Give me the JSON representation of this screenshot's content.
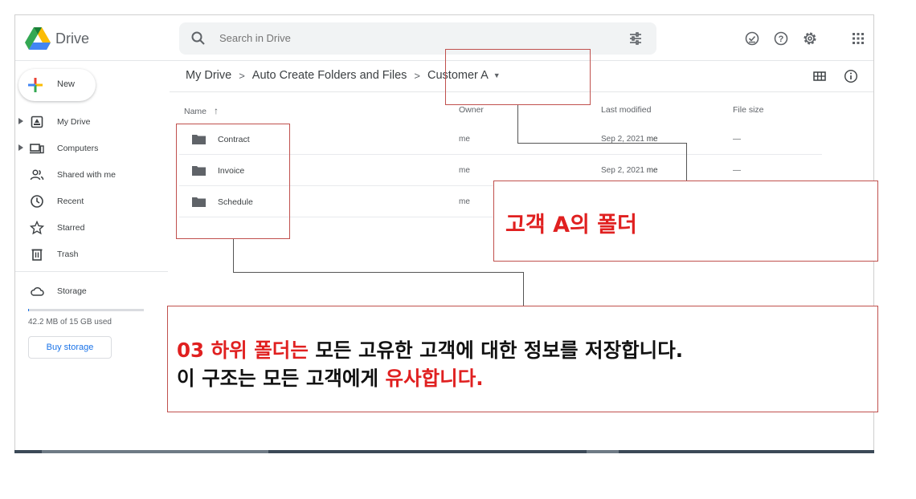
{
  "app": {
    "name": "Drive"
  },
  "search": {
    "placeholder": "Search in Drive"
  },
  "header_icons": [
    "offline-ready-icon",
    "help-icon",
    "settings-icon",
    "apps-grid-icon"
  ],
  "sidebar": {
    "new_label": "New",
    "items": [
      {
        "label": "My Drive",
        "icon": "my-drive-icon"
      },
      {
        "label": "Computers",
        "icon": "computers-icon"
      },
      {
        "label": "Shared with me",
        "icon": "shared-icon"
      },
      {
        "label": "Recent",
        "icon": "recent-icon"
      },
      {
        "label": "Starred",
        "icon": "starred-icon"
      },
      {
        "label": "Trash",
        "icon": "trash-icon"
      }
    ],
    "storage_label": "Storage",
    "storage_used_text": "42.2 MB of 15 GB used",
    "storage_used_fraction": 0.003,
    "buy_storage_label": "Buy storage"
  },
  "breadcrumb": {
    "items": [
      "My Drive",
      "Auto Create Folders and Files",
      "Customer A"
    ],
    "separator": ">"
  },
  "columns": {
    "name": "Name",
    "sort_arrow": "↑",
    "owner": "Owner",
    "last_modified": "Last modified",
    "file_size": "File size"
  },
  "files": [
    {
      "name": "Contract",
      "owner": "me",
      "modified_date": "Sep 2, 2021",
      "modified_by": "me",
      "size": "—"
    },
    {
      "name": "Invoice",
      "owner": "me",
      "modified_date": "Sep 2, 2021",
      "modified_by": "me",
      "size": "—"
    },
    {
      "name": "Schedule",
      "owner": "me",
      "modified_date": "",
      "modified_by": "",
      "size": ""
    }
  ],
  "annotations": {
    "callout_a": "고객 A의 폴더",
    "callout_b_line1_red": "03 하위 폴더는",
    "callout_b_line1_rest": " 모든 고유한 고객에 대한 정보를 저장합니다.",
    "callout_b_line2_rest": "이 구조는 모든 고객에게 ",
    "callout_b_line2_red": "유사합니다."
  },
  "colors": {
    "accent": "#1a73e8",
    "annotation_border": "#c0504d",
    "annotation_red": "#e02020"
  }
}
